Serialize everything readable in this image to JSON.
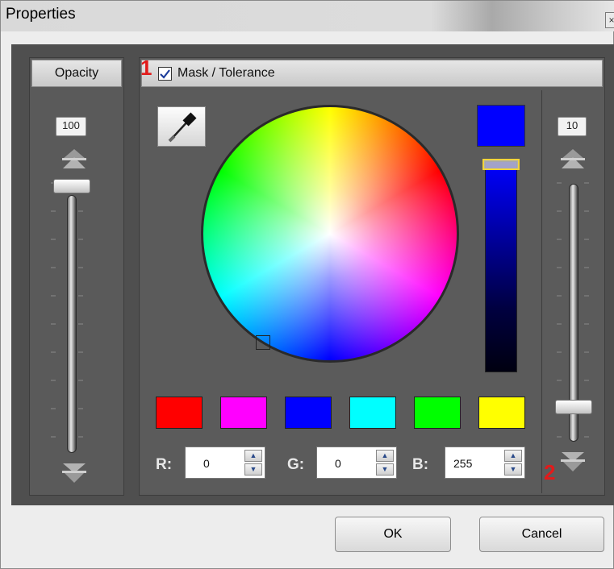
{
  "window": {
    "title": "Properties",
    "close_glyph": "×"
  },
  "opacity": {
    "header": "Opacity",
    "value": "100",
    "level": 1.0
  },
  "mask": {
    "label": "Mask / Tolerance",
    "checked": true,
    "selected_color": "#0000ff"
  },
  "tolerance": {
    "value": "10",
    "level": 0.1
  },
  "swatches": [
    {
      "color": "#ff0000"
    },
    {
      "color": "#ff00ff"
    },
    {
      "color": "#0000ff"
    },
    {
      "color": "#00ffff"
    },
    {
      "color": "#00ff00"
    },
    {
      "color": "#ffff00"
    }
  ],
  "rgb": {
    "r": {
      "label": "R:",
      "value": "0"
    },
    "g": {
      "label": "G:",
      "value": "0"
    },
    "b": {
      "label": "B:",
      "value": "255"
    }
  },
  "buttons": {
    "ok": "OK",
    "cancel": "Cancel"
  },
  "annotations": {
    "one": "1",
    "two": "2"
  },
  "icons": [
    "eyedropper-icon",
    "arrow-up-icon",
    "arrow-down-icon",
    "spin-up-icon",
    "spin-down-icon",
    "checkbox-icon"
  ]
}
